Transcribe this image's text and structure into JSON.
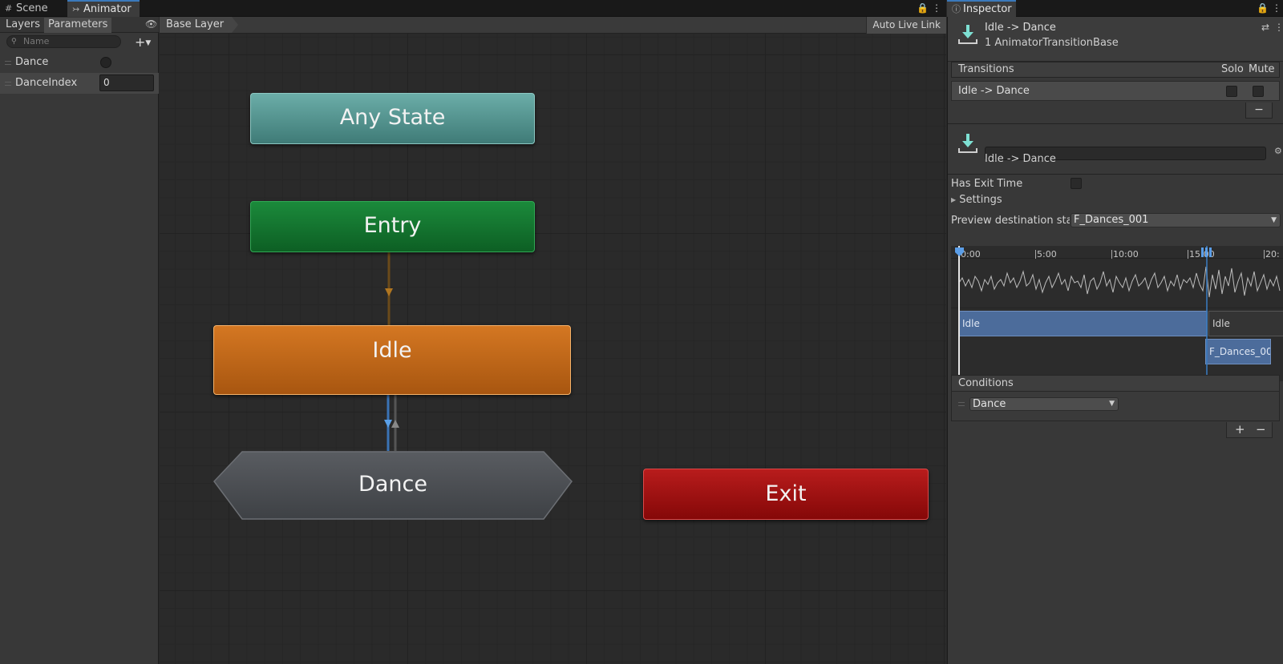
{
  "tabs": {
    "scene": "Scene",
    "animator": "Animator",
    "inspector": "Inspector"
  },
  "left_panel": {
    "tab_layers": "Layers",
    "tab_parameters": "Parameters",
    "search_placeholder": "Name",
    "parameters": [
      {
        "name": "Dance",
        "type": "trigger"
      },
      {
        "name": "DanceIndex",
        "type": "int",
        "value": "0"
      }
    ]
  },
  "graph": {
    "breadcrumb": "Base Layer",
    "auto_live_link": "Auto Live Link",
    "nodes": {
      "any_state": "Any State",
      "entry": "Entry",
      "idle": "Idle",
      "dance": "Dance",
      "exit": "Exit"
    }
  },
  "inspector": {
    "header_title": "Idle -> Dance",
    "header_subtitle": "1 AnimatorTransitionBase",
    "transitions_header": "Transitions",
    "solo_label": "Solo",
    "mute_label": "Mute",
    "transition_row": "Idle -> Dance",
    "minus": "−",
    "transition_name": "Idle -> Dance",
    "has_exit_time": "Has Exit Time",
    "settings": "Settings",
    "preview_label": "Preview destination state",
    "preview_value": "F_Dances_001",
    "timeline_ticks": [
      "0:00",
      "5:00",
      "10:00",
      "15:00",
      "20:"
    ],
    "clip_idle_1": "Idle",
    "clip_idle_2": "Idle",
    "clip_dance": "F_Dances_00",
    "conditions_header": "Conditions",
    "condition_param": "Dance",
    "plus": "+",
    "minus2": "−"
  },
  "colors": {
    "any_state": "#4f918c",
    "entry": "#137a33",
    "idle": "#c26a18",
    "dance": "#4b4e52",
    "exit": "#a11212",
    "accent_blue": "#3a79bb"
  }
}
